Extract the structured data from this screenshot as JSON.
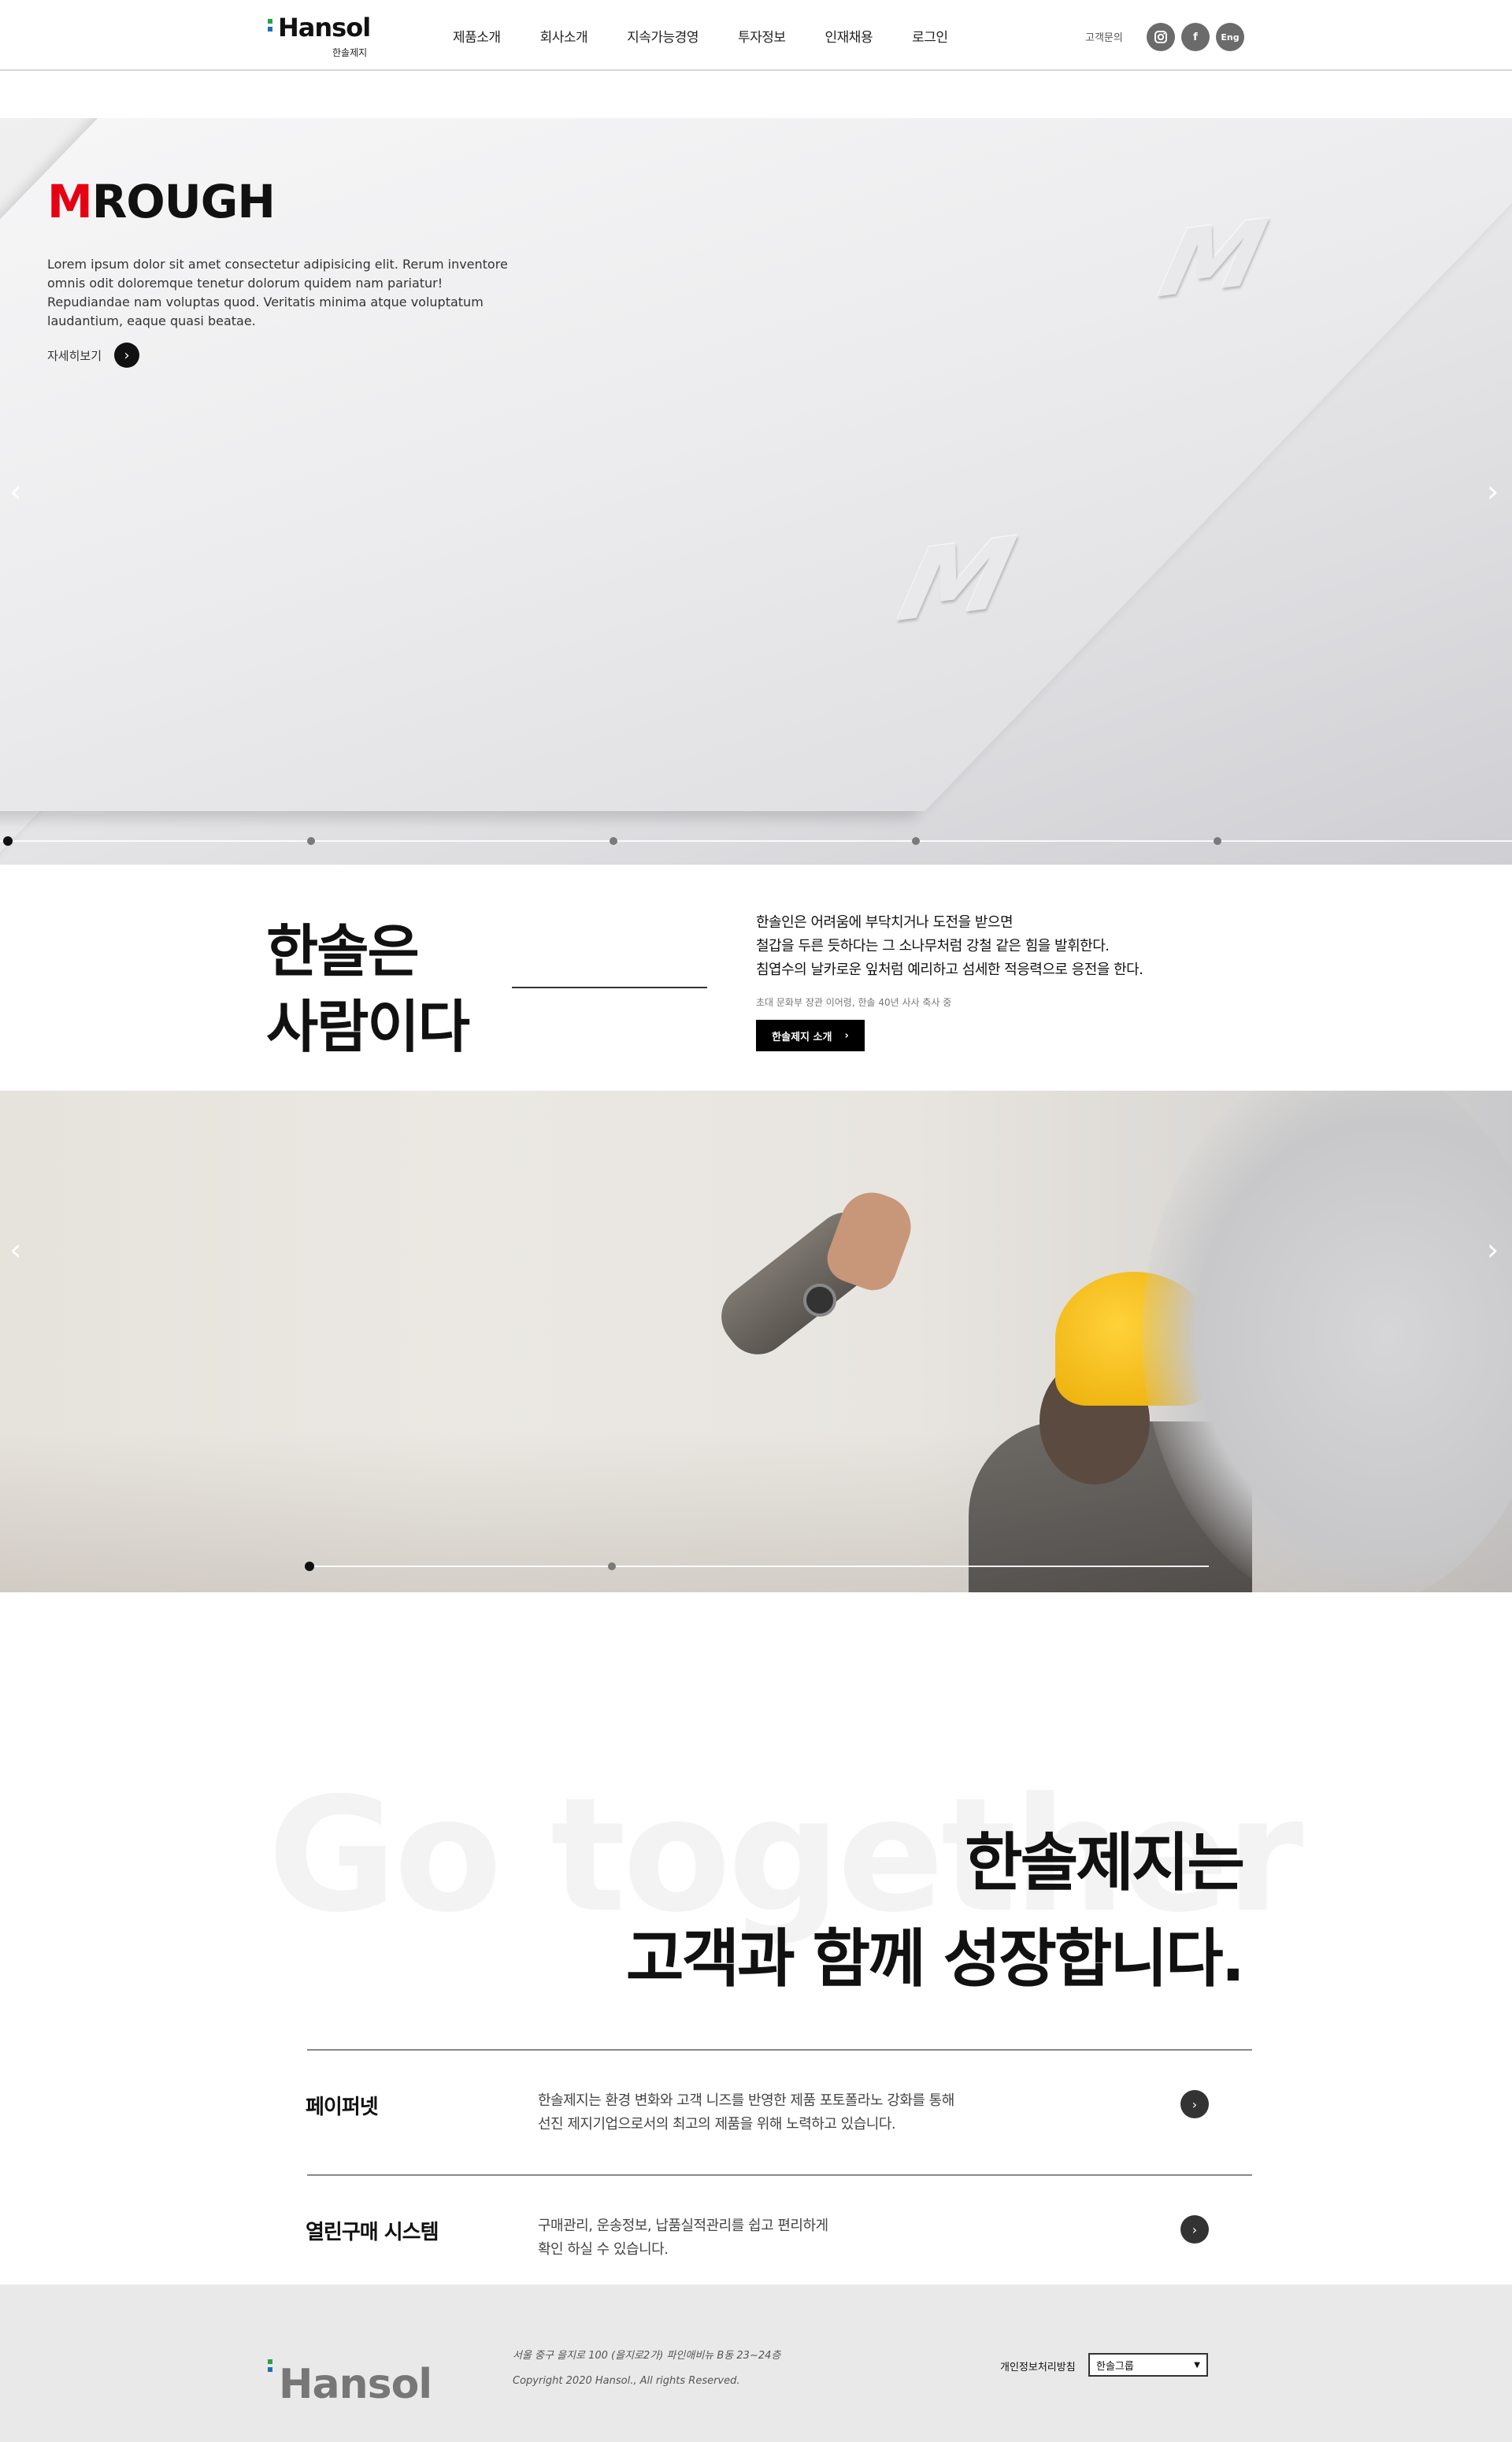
{
  "header": {
    "logo": {
      "name": "Hansol",
      "sub": "한솔제지"
    },
    "nav": [
      "제품소개",
      "회사소개",
      "지속가능경영",
      "투자정보",
      "인재채용",
      "로그인"
    ],
    "customer_link": "고객문의",
    "sns": {
      "instagram_icon": "instagram-icon",
      "facebook_label": "f",
      "english_label": "Eng"
    }
  },
  "hero": {
    "title_first": "M",
    "title_rest": "ROUGH",
    "description": "Lorem ipsum dolor sit amet consectetur adipisicing elit. Rerum inventore omnis odit doloremque tenetur dolorum quidem nam pariatur! Repudiandae nam voluptas quod. Veritatis minima atque voluptatum laudantium, eaque quasi beatae.",
    "more_label": "자세히보기",
    "slide_count": 5,
    "active_slide": 1
  },
  "intro": {
    "title_line1": "한솔은",
    "title_line2": "사람이다",
    "text_line1": "한솔인은 어려움에 부닥치거나 도전을 받으면",
    "text_line2": "철갑을 두른 듯하다는 그 소나무처럼 강철 같은 힘을 발휘한다.",
    "text_line3": "침엽수의 날카로운 잎처럼 예리하고 섬세한 적응력으로 응전을 한다.",
    "note": "초대 문화부 장관 이어령, 한솔 40년 사사 축사 중",
    "button_label": "한솔제지 소개"
  },
  "slide2": {
    "slide_count": 2,
    "active_slide": 1
  },
  "together": {
    "bg_text": "Go together",
    "title_line1": "한솔제지는",
    "title_line2": "고객과 함께 성장합니다.",
    "services": [
      {
        "name": "페이퍼넷",
        "desc_line1": "한솔제지는 환경 변화와 고객 니즈를 반영한 제품 포토폴라노 강화를 통해",
        "desc_line2": "선진 제지기업으로서의 최고의 제품을 위해 노력하고 있습니다."
      },
      {
        "name": "열린구매 시스템",
        "desc_line1": "구매관리, 운송정보, 납품실적관리를 쉽고 편리하게",
        "desc_line2": "확인 하실 수 있습니다."
      }
    ]
  },
  "footer": {
    "logo": "Hansol",
    "address": "서울 중구 을지로 100 (을지로2가) 파인애비뉴 B동 23~24층",
    "copyright": "Copyright 2020 Hansol., All rights Reserved.",
    "policy_label": "개인정보처리방침",
    "family_select_value": "한솔그룹"
  },
  "colors": {
    "brand_red": "#e60012",
    "logo_blue": "#1d6fb8",
    "logo_green": "#2aa24a"
  }
}
